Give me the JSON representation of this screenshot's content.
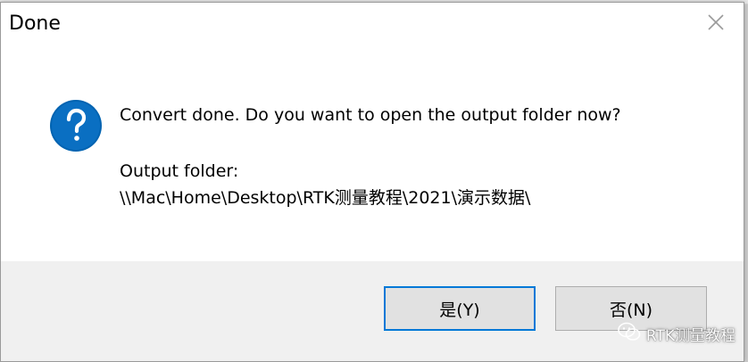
{
  "dialog": {
    "title": "Done",
    "close_icon": "close-icon",
    "question_icon": "question-icon",
    "message": "Convert done. Do you want to open the output folder now?",
    "folder_label": "Output folder:",
    "folder_path": "\\\\Mac\\Home\\Desktop\\RTK测量教程\\2021\\演示数据\\",
    "buttons": {
      "yes_label": "是(Y)",
      "no_label": "否(N)"
    }
  },
  "watermark": {
    "text": "RTK测量教程",
    "icon": "wechat-icon"
  },
  "colors": {
    "question_icon_fill": "#0063b1",
    "default_button_border": "#0078d7",
    "footer_background": "#f0f0f0"
  }
}
